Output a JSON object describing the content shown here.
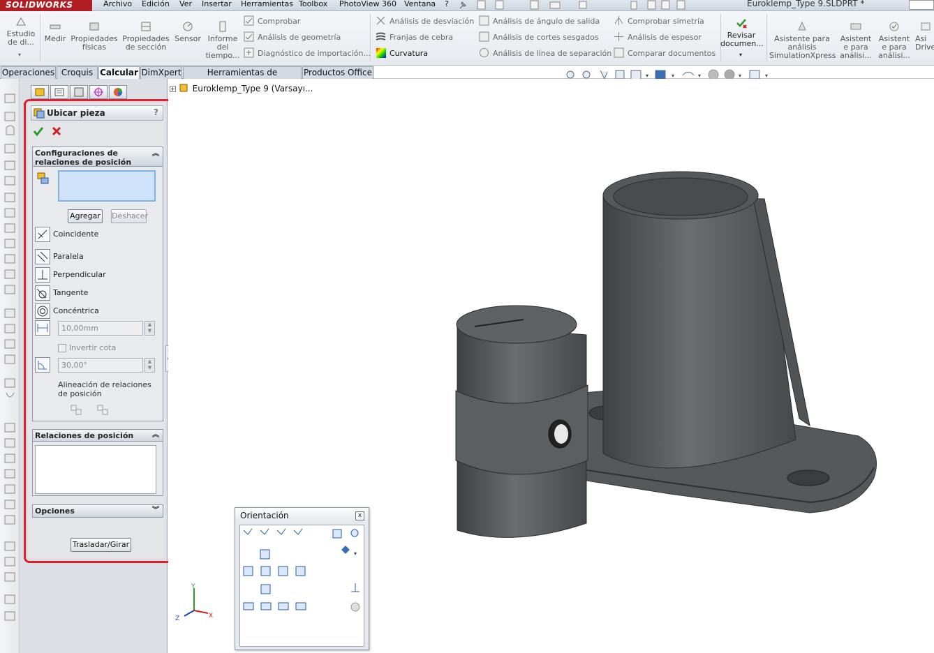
{
  "app": {
    "logo": "SOLIDWORKS",
    "doc_title": "Euroklemp_Type 9.SLDPRT *"
  },
  "menu": [
    "Archivo",
    "Edición",
    "Ver",
    "Insertar",
    "Herramientas",
    "Toolbox",
    "PhotoView 360",
    "Ventana",
    "?"
  ],
  "ribbon": {
    "big": [
      {
        "label": "Estudio de di...",
        "icon": "study-icon"
      },
      {
        "label": "Medir",
        "icon": "measure-icon"
      },
      {
        "label": "Propiedades físicas",
        "icon": "mass-properties-icon"
      },
      {
        "label": "Propiedades de sección",
        "icon": "section-properties-icon"
      },
      {
        "label": "Sensor",
        "icon": "sensor-icon"
      },
      {
        "label": "Informe del tiempo...",
        "icon": "performance-report-icon"
      }
    ],
    "col1": [
      "Comprobar",
      "Análisis de geometría",
      "Diagnóstico de importación..."
    ],
    "col2": [
      "Análisis de desviación",
      "Franjas de cebra",
      "Curvatura"
    ],
    "col3": [
      "Análisis de ángulo de salida",
      "Análisis de cortes sesgados",
      "Análisis de línea de separación"
    ],
    "col4": [
      "Comprobar simetría",
      "Análisis de espesor",
      "Comparar documentos"
    ],
    "big2": [
      {
        "label": "Revisar documen...",
        "icon": "check-document-icon"
      },
      {
        "label": "Asistente para análisis SimulationXpress",
        "icon": "simulationxpress-icon"
      },
      {
        "label": "Asistent e para análisi...",
        "icon": "floxpress-icon"
      },
      {
        "label": "Asistent e para análisi...",
        "icon": "dfmxpress-icon"
      },
      {
        "label": "Asi Drive",
        "icon": "driveworks-icon"
      }
    ]
  },
  "tabs": [
    "Operaciones",
    "Croquis",
    "Calcular",
    "DimXpert",
    "Herramientas de renderizado",
    "Productos Office"
  ],
  "active_tab": "Calcular",
  "tree": {
    "item": "Euroklemp_Type 9  (Varsayı..."
  },
  "pm": {
    "title": "Ubicar pieza",
    "help": "?",
    "group1": "Configuraciones de relaciones de posición",
    "add": "Agregar",
    "undo": "Deshacer",
    "mates": [
      "Coincidente",
      "Paralela",
      "Perpendicular",
      "Tangente",
      "Concéntrica"
    ],
    "distance": "10,00mm",
    "flip": "Invertir cota",
    "angle": "30,00°",
    "align": "Alineación de relaciones de posición",
    "group2": "Relaciones de posición",
    "group3": "Opciones",
    "move": "Trasladar/Girar"
  },
  "orientation": {
    "title": "Orientación",
    "close": "x"
  },
  "axes": {
    "x": "X",
    "y": "Y",
    "z": "Z"
  },
  "colors": {
    "highlight": "#e0202a",
    "part": "#5a5e60",
    "logo": "#b01e24"
  }
}
